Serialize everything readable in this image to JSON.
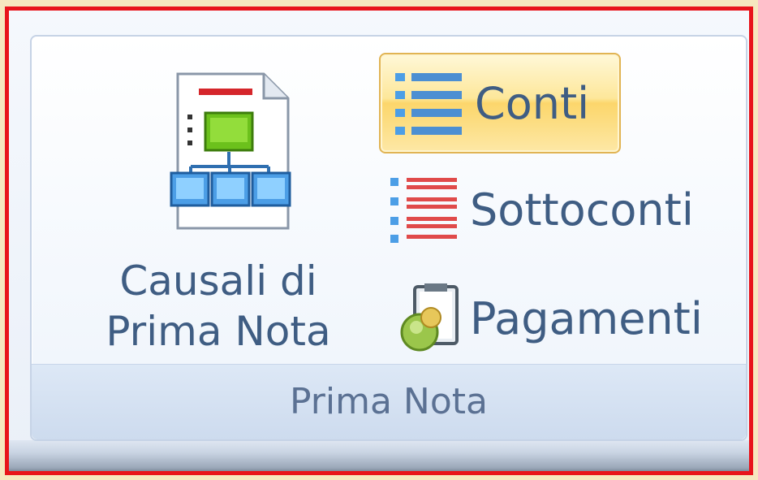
{
  "ribbon": {
    "group": {
      "label": "Prima Nota",
      "large_button": {
        "label_line1": "Causali di",
        "label_line2": "Prima Nota",
        "icon": "document-network-icon"
      },
      "small_buttons": [
        {
          "label": "Conti",
          "icon": "list-icon",
          "state": "hover"
        },
        {
          "label": "Sottoconti",
          "icon": "sublist-icon"
        },
        {
          "label": "Pagamenti",
          "icon": "payment-icon"
        }
      ]
    }
  },
  "colors": {
    "highlight_border": "#e8141b",
    "label_text": "#3f5d83",
    "hover_fill": "#fcd66b"
  }
}
